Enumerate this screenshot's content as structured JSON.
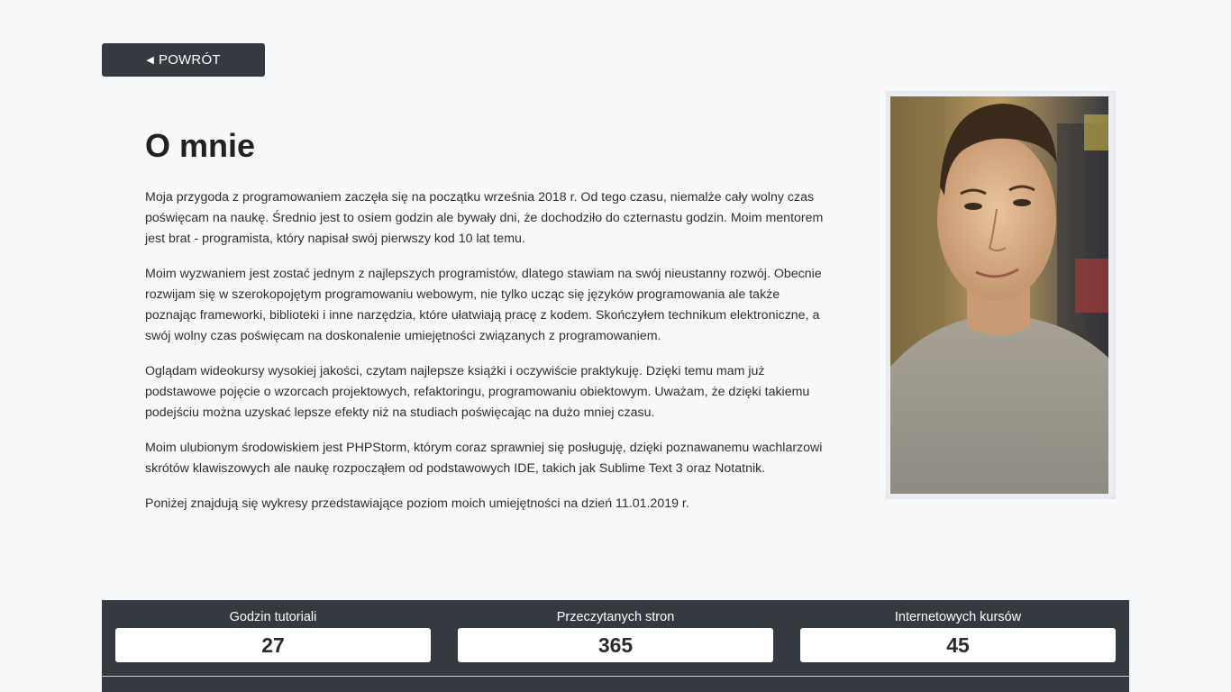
{
  "nav": {
    "back_label": "POWRÓT",
    "back_icon": "triangle-left-icon"
  },
  "about": {
    "title": "O mnie",
    "paragraphs": [
      "Moja przygoda z programowaniem zaczęła się na początku września 2018 r. Od tego czasu, niemalże cały wolny czas poświęcam na naukę. Średnio jest to osiem godzin ale bywały dni, że dochodziło do czternastu godzin. Moim mentorem jest brat - programista, który napisał swój pierwszy kod 10 lat temu.",
      "Moim wyzwaniem jest zostać jednym z najlepszych programistów, dlatego stawiam na swój nieustanny rozwój. Obecnie rozwijam się w szerokopojętym programowaniu webowym, nie tylko ucząc się języków programowania ale także poznając frameworki, biblioteki i inne narzędzia, które ułatwiają pracę z kodem. Skończyłem technikum elektroniczne, a swój wolny czas poświęcam na doskonalenie umiejętności związanych z programowaniem.",
      "Oglądam wideokursy wysokiej jakości, czytam najlepsze książki i oczywiście praktykuję. Dzięki temu mam już podstawowe pojęcie o wzorcach projektowych, refaktoringu, programowaniu obiektowym. Uważam, że dzięki takiemu podejściu można uzyskać lepsze efekty niż na studiach poświęcając na dużo mniej czasu.",
      "Moim ulubionym środowiskiem jest PHPStorm, którym coraz sprawniej się posługuję, dzięki poznawanemu wachlarzowi skrótów klawiszowych ale naukę rozpocząłem od podstawowych IDE, takich jak Sublime Text 3 oraz Notatnik.",
      "Poniżej znajdują się wykresy przedstawiające poziom moich umiejętności na dzień 11.01.2019 r."
    ]
  },
  "photo": {
    "subject": "portrait-photo"
  },
  "stats": [
    {
      "label": "Godzin tutoriali",
      "value": "27"
    },
    {
      "label": "Przeczytanych stron",
      "value": "365"
    },
    {
      "label": "Internetowych kursów",
      "value": "45"
    }
  ],
  "colors": {
    "page_bg": "#f7f8fa",
    "dark": "#343a40",
    "text": "#2f2f2f"
  }
}
